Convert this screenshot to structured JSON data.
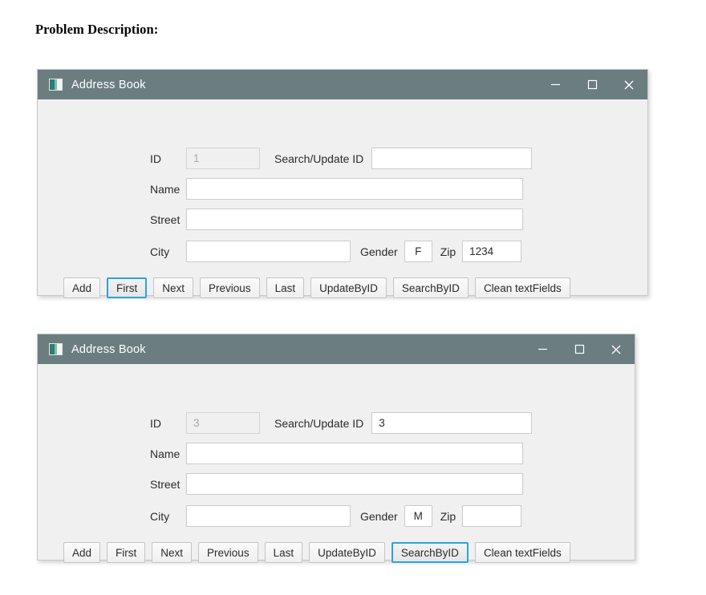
{
  "heading": "Problem Description:",
  "window_controls": {
    "minimize": "minimize",
    "maximize": "maximize",
    "close": "close"
  },
  "fields": {
    "id_label": "ID",
    "search_update_label": "Search/Update ID",
    "name_label": "Name",
    "street_label": "Street",
    "city_label": "City",
    "gender_label": "Gender",
    "zip_label": "Zip"
  },
  "buttons": {
    "add": "Add",
    "first": "First",
    "next": "Next",
    "previous": "Previous",
    "last": "Last",
    "update_by_id": "UpdateByID",
    "search_by_id": "SearchByID",
    "clean": "Clean textFields"
  },
  "accent": {
    "titlebar": "#6c7d80",
    "focus_ring": "#2aa3df",
    "window_body": "#f0f0f0"
  },
  "windows": [
    {
      "title": "Address Book",
      "id_value": "1",
      "search_update_value": "",
      "name_value": "",
      "street_value": "",
      "city_value": "",
      "gender_value": "F",
      "zip_value": "1234",
      "focused_button": "First"
    },
    {
      "title": "Address Book",
      "id_value": "3",
      "search_update_value": "3",
      "name_value": "",
      "street_value": "",
      "city_value": "",
      "gender_value": "M",
      "zip_value": "",
      "focused_button": "SearchByID"
    }
  ]
}
